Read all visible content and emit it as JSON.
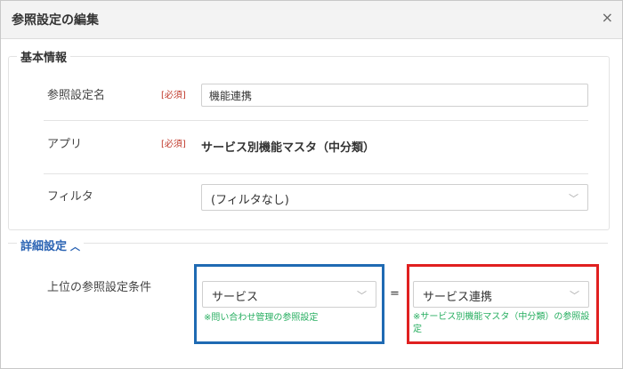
{
  "dialog": {
    "title": "参照設定の編集",
    "close_glyph": "×"
  },
  "basic": {
    "legend": "基本情報",
    "name_label": "参照設定名",
    "name_required": "[必須]",
    "name_value": "機能連携",
    "app_label": "アプリ",
    "app_required": "[必須]",
    "app_value": "サービス別機能マスタ（中分類）",
    "filter_label": "フィルタ",
    "filter_value": "(フィルタなし)"
  },
  "detail": {
    "legend": "詳細設定",
    "chevron": "^",
    "parent_label": "上位の参照設定条件",
    "left_select": "サービス",
    "left_note": "※問い合わせ管理の参照設定",
    "equals": "=",
    "right_select": "サービス連携",
    "right_note": "※サービス別機能マスタ（中分類）の参照設定",
    "highlight_colors": {
      "left": "#1f6ab3",
      "right": "#e02020"
    }
  },
  "icons": {
    "close": "close-icon",
    "dropdown": "chevron-down-icon",
    "collapse": "chevron-up-icon"
  }
}
